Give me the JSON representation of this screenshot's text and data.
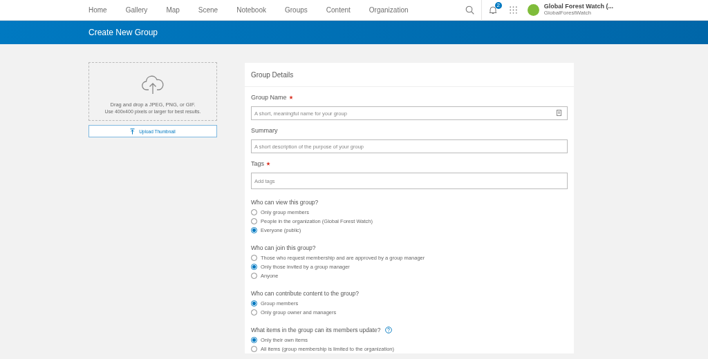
{
  "nav": {
    "items": [
      "Home",
      "Gallery",
      "Map",
      "Scene",
      "Notebook",
      "Groups",
      "Content",
      "Organization"
    ],
    "notification_count": "2",
    "user": {
      "name": "Global Forest Watch (...",
      "username": "GlobalForestWatch"
    }
  },
  "page_title": "Create New Group",
  "thumbnail": {
    "drop_text": "Drag and drop a JPEG, PNG, or GIF.",
    "hint": "Use 400x400 pixels or larger for best results.",
    "upload_button": "Upload Thumbnail"
  },
  "form": {
    "title": "Group Details",
    "fields": [
      {
        "label": "Group Name",
        "required": true,
        "placeholder": "A short, meaningful name for your group"
      },
      {
        "label": "Summary",
        "required": false,
        "placeholder": "A short description of the purpose of your group"
      },
      {
        "label": "Tags",
        "required": true,
        "placeholder": "Add tags"
      }
    ],
    "radio_groups": [
      {
        "question": "Who can view this group?",
        "help": false,
        "options": [
          {
            "label": "Only group members",
            "selected": false
          },
          {
            "label": "People in the organization (Global Forest Watch)",
            "selected": false
          },
          {
            "label": "Everyone (public)",
            "selected": true
          }
        ]
      },
      {
        "question": "Who can join this group?",
        "help": false,
        "options": [
          {
            "label": "Those who request membership and are approved by a group manager",
            "selected": false
          },
          {
            "label": "Only those invited by a group manager",
            "selected": true
          },
          {
            "label": "Anyone",
            "selected": false
          }
        ]
      },
      {
        "question": "Who can contribute content to the group?",
        "help": false,
        "options": [
          {
            "label": "Group members",
            "selected": true
          },
          {
            "label": "Only group owner and managers",
            "selected": false
          }
        ]
      },
      {
        "question": "What items in the group can its members update?",
        "help": true,
        "options": [
          {
            "label": "Only their own items",
            "selected": true
          },
          {
            "label": "All items (group membership is limited to the organization)",
            "selected": false
          }
        ]
      }
    ]
  }
}
